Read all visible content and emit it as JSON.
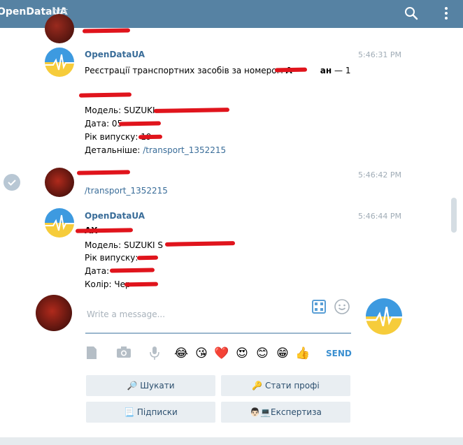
{
  "header": {
    "title": "OpenDataUA",
    "subtitle": "bot"
  },
  "messages": [
    {
      "sender": "OpenDataUA",
      "time": "5:46:31 PM",
      "lines": [
        "Реєстрації транспортних засобів за номером",
        "Модель: SUZUKI",
        "Дата: 05",
        "Рік випуску: 19",
        "Детальніше: "
      ],
      "plate_suffix": "ан",
      "count": "— 1",
      "link": "/transport_1352215"
    },
    {
      "sender": "",
      "time": "5:46:42 PM",
      "link": "/transport_1352215"
    },
    {
      "sender": "OpenDataUA",
      "time": "5:46:44 PM",
      "plate": "АХ",
      "lines": [
        "Модель: SUZUKI S",
        "Рік випуску:",
        "Дата:",
        "Колір: Чер"
      ]
    }
  ],
  "composer": {
    "placeholder": "Write a message...",
    "send_label": "SEND",
    "emojis": [
      "😂",
      "😘",
      "❤️",
      "😍",
      "😊",
      "😁",
      "👍"
    ]
  },
  "keyboard": [
    {
      "label": "🔎 Шукати"
    },
    {
      "label": "🔑 Стати профі"
    },
    {
      "label": "📃 Підписки"
    },
    {
      "label": "👨🏻💻Експертиза"
    }
  ],
  "colors": {
    "header": "#5682a3",
    "link": "#3a6d99",
    "send": "#3a8fd0"
  }
}
